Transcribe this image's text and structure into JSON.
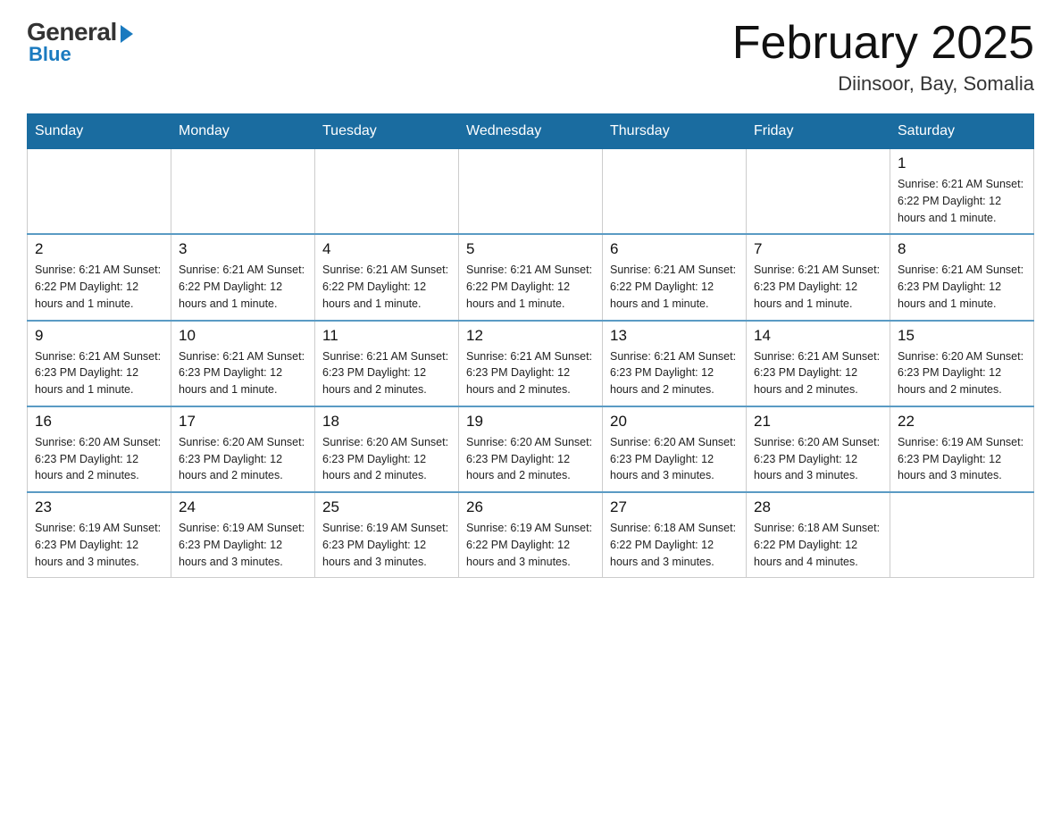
{
  "header": {
    "logo_general": "General",
    "logo_blue": "Blue",
    "month_title": "February 2025",
    "location": "Diinsoor, Bay, Somalia"
  },
  "weekdays": [
    "Sunday",
    "Monday",
    "Tuesday",
    "Wednesday",
    "Thursday",
    "Friday",
    "Saturday"
  ],
  "weeks": [
    [
      {
        "day": "",
        "info": ""
      },
      {
        "day": "",
        "info": ""
      },
      {
        "day": "",
        "info": ""
      },
      {
        "day": "",
        "info": ""
      },
      {
        "day": "",
        "info": ""
      },
      {
        "day": "",
        "info": ""
      },
      {
        "day": "1",
        "info": "Sunrise: 6:21 AM\nSunset: 6:22 PM\nDaylight: 12 hours and 1 minute."
      }
    ],
    [
      {
        "day": "2",
        "info": "Sunrise: 6:21 AM\nSunset: 6:22 PM\nDaylight: 12 hours and 1 minute."
      },
      {
        "day": "3",
        "info": "Sunrise: 6:21 AM\nSunset: 6:22 PM\nDaylight: 12 hours and 1 minute."
      },
      {
        "day": "4",
        "info": "Sunrise: 6:21 AM\nSunset: 6:22 PM\nDaylight: 12 hours and 1 minute."
      },
      {
        "day": "5",
        "info": "Sunrise: 6:21 AM\nSunset: 6:22 PM\nDaylight: 12 hours and 1 minute."
      },
      {
        "day": "6",
        "info": "Sunrise: 6:21 AM\nSunset: 6:22 PM\nDaylight: 12 hours and 1 minute."
      },
      {
        "day": "7",
        "info": "Sunrise: 6:21 AM\nSunset: 6:23 PM\nDaylight: 12 hours and 1 minute."
      },
      {
        "day": "8",
        "info": "Sunrise: 6:21 AM\nSunset: 6:23 PM\nDaylight: 12 hours and 1 minute."
      }
    ],
    [
      {
        "day": "9",
        "info": "Sunrise: 6:21 AM\nSunset: 6:23 PM\nDaylight: 12 hours and 1 minute."
      },
      {
        "day": "10",
        "info": "Sunrise: 6:21 AM\nSunset: 6:23 PM\nDaylight: 12 hours and 1 minute."
      },
      {
        "day": "11",
        "info": "Sunrise: 6:21 AM\nSunset: 6:23 PM\nDaylight: 12 hours and 2 minutes."
      },
      {
        "day": "12",
        "info": "Sunrise: 6:21 AM\nSunset: 6:23 PM\nDaylight: 12 hours and 2 minutes."
      },
      {
        "day": "13",
        "info": "Sunrise: 6:21 AM\nSunset: 6:23 PM\nDaylight: 12 hours and 2 minutes."
      },
      {
        "day": "14",
        "info": "Sunrise: 6:21 AM\nSunset: 6:23 PM\nDaylight: 12 hours and 2 minutes."
      },
      {
        "day": "15",
        "info": "Sunrise: 6:20 AM\nSunset: 6:23 PM\nDaylight: 12 hours and 2 minutes."
      }
    ],
    [
      {
        "day": "16",
        "info": "Sunrise: 6:20 AM\nSunset: 6:23 PM\nDaylight: 12 hours and 2 minutes."
      },
      {
        "day": "17",
        "info": "Sunrise: 6:20 AM\nSunset: 6:23 PM\nDaylight: 12 hours and 2 minutes."
      },
      {
        "day": "18",
        "info": "Sunrise: 6:20 AM\nSunset: 6:23 PM\nDaylight: 12 hours and 2 minutes."
      },
      {
        "day": "19",
        "info": "Sunrise: 6:20 AM\nSunset: 6:23 PM\nDaylight: 12 hours and 2 minutes."
      },
      {
        "day": "20",
        "info": "Sunrise: 6:20 AM\nSunset: 6:23 PM\nDaylight: 12 hours and 3 minutes."
      },
      {
        "day": "21",
        "info": "Sunrise: 6:20 AM\nSunset: 6:23 PM\nDaylight: 12 hours and 3 minutes."
      },
      {
        "day": "22",
        "info": "Sunrise: 6:19 AM\nSunset: 6:23 PM\nDaylight: 12 hours and 3 minutes."
      }
    ],
    [
      {
        "day": "23",
        "info": "Sunrise: 6:19 AM\nSunset: 6:23 PM\nDaylight: 12 hours and 3 minutes."
      },
      {
        "day": "24",
        "info": "Sunrise: 6:19 AM\nSunset: 6:23 PM\nDaylight: 12 hours and 3 minutes."
      },
      {
        "day": "25",
        "info": "Sunrise: 6:19 AM\nSunset: 6:23 PM\nDaylight: 12 hours and 3 minutes."
      },
      {
        "day": "26",
        "info": "Sunrise: 6:19 AM\nSunset: 6:22 PM\nDaylight: 12 hours and 3 minutes."
      },
      {
        "day": "27",
        "info": "Sunrise: 6:18 AM\nSunset: 6:22 PM\nDaylight: 12 hours and 3 minutes."
      },
      {
        "day": "28",
        "info": "Sunrise: 6:18 AM\nSunset: 6:22 PM\nDaylight: 12 hours and 4 minutes."
      },
      {
        "day": "",
        "info": ""
      }
    ]
  ]
}
